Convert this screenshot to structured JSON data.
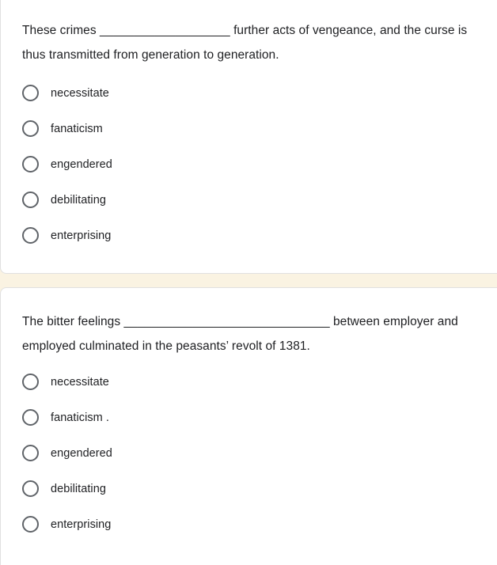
{
  "background": {
    "page_color": "#faf3e2",
    "card_color": "#ffffff",
    "text_color": "#202124",
    "radio_border_color": "#5f6368"
  },
  "cards": [
    {
      "id": "question-card-1",
      "question": "These crimes ___________________ further acts of vengeance, and the curse is thus transmitted from generation to generation.",
      "options": [
        {
          "label": "necessitate",
          "selected": false
        },
        {
          "label": "fanaticism",
          "selected": false
        },
        {
          "label": "engendered",
          "selected": false
        },
        {
          "label": "debilitating",
          "selected": false
        },
        {
          "label": "enterprising",
          "selected": false
        }
      ]
    },
    {
      "id": "question-card-2",
      "question": "The bitter feelings ______________________________ between employer and employed culminated in the peasants’ revolt of 1381.",
      "options": [
        {
          "label": "necessitate",
          "selected": false
        },
        {
          "label": "fanaticism .",
          "selected": false
        },
        {
          "label": "engendered",
          "selected": false
        },
        {
          "label": "debilitating",
          "selected": false
        },
        {
          "label": "enterprising",
          "selected": false
        }
      ]
    }
  ]
}
